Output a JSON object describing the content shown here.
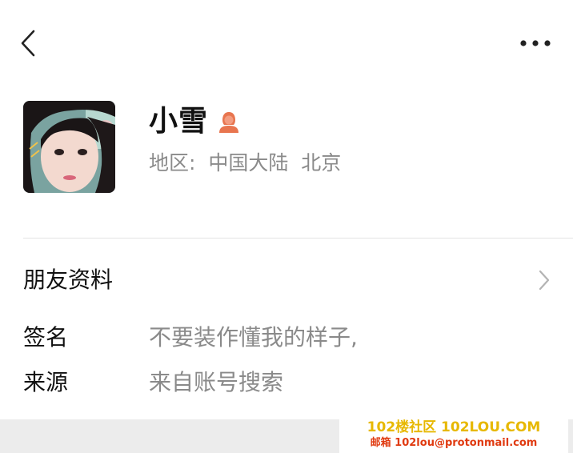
{
  "profile": {
    "name": "小雪",
    "region": "地区:  中国大陆  北京",
    "gender_icon": "female-user-icon"
  },
  "friend_info": {
    "title": "朋友资料"
  },
  "fields": {
    "signature_label": "签名",
    "signature_value": "不要装作懂我的样子,",
    "source_label": "来源",
    "source_value": "来自账号搜索"
  },
  "watermark": {
    "line1": "102楼社区 102LOU.COM",
    "line2": "邮箱 102lou@protonmail.com"
  },
  "colors": {
    "accent_orange": "#e8754f",
    "text_primary": "#111111",
    "text_secondary": "#8a8a8a"
  }
}
